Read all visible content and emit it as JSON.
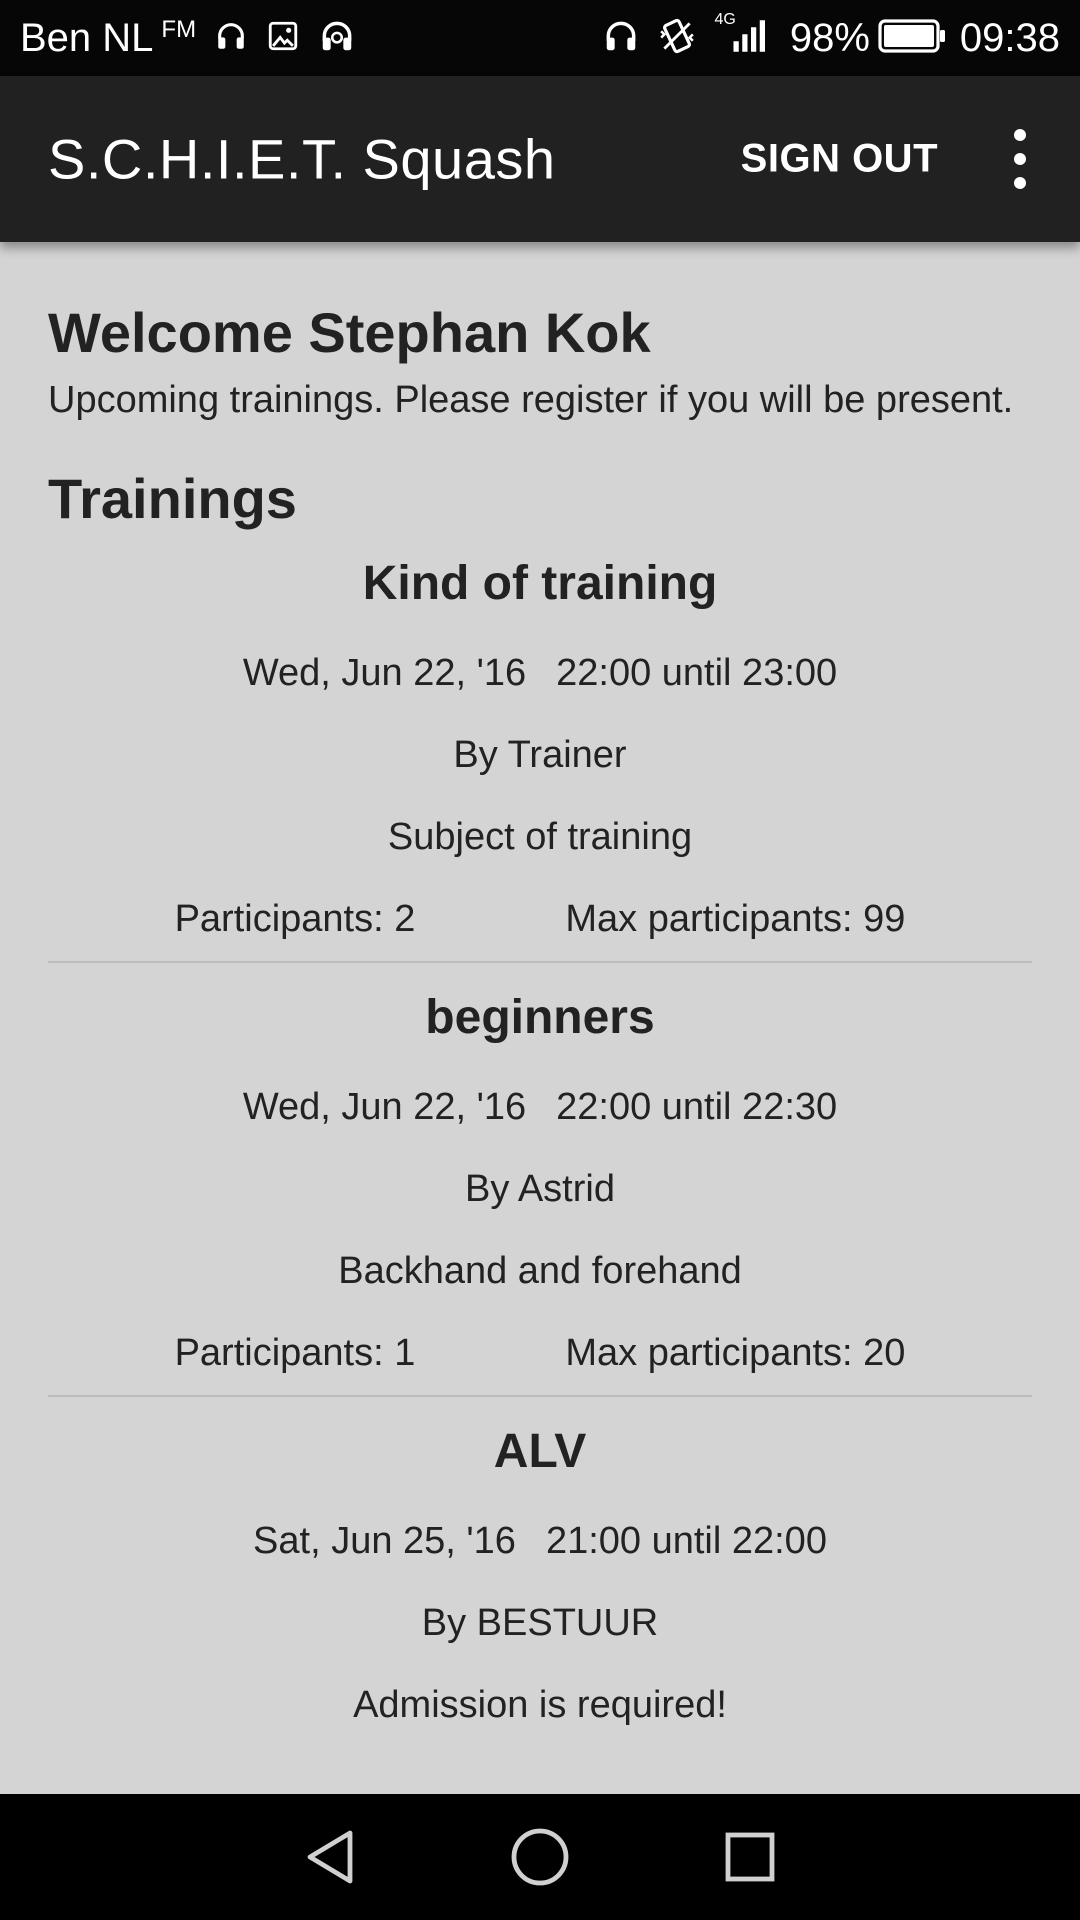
{
  "status_bar": {
    "carrier": "Ben NL",
    "fm": "FM",
    "network": "4G",
    "battery": "98%",
    "time": "09:38"
  },
  "app_bar": {
    "title": "S.C.H.I.E.T. Squash",
    "sign_out": "SIGN OUT",
    "menu_icon": "overflow-menu-icon"
  },
  "welcome": {
    "title": "Welcome Stephan Kok",
    "subtitle": "Upcoming trainings. Please register if you will be present."
  },
  "trainings_heading": "Trainings",
  "trainings": [
    {
      "name": "Kind of training",
      "date": "Wed, Jun 22, '16",
      "time": "22:00 until 23:00",
      "trainer": "By Trainer",
      "subject": "Subject of training",
      "participants": "Participants: 2",
      "max_participants": "Max participants: 99"
    },
    {
      "name": "beginners",
      "date": "Wed, Jun 22, '16",
      "time": "22:00 until 22:30",
      "trainer": "By Astrid",
      "subject": "Backhand and forehand",
      "participants": "Participants: 1",
      "max_participants": "Max participants: 20"
    },
    {
      "name": "ALV",
      "date": "Sat, Jun 25, '16",
      "time": "21:00 until 22:00",
      "trainer": "By BESTUUR",
      "subject": "Admission is required!",
      "participants": "",
      "max_participants": ""
    }
  ],
  "nav": {
    "back": "back-icon",
    "home": "home-icon",
    "recents": "recents-icon"
  },
  "colors": {
    "app_bar": "#212121",
    "background": "#d4d4d4",
    "status_bar": "#060606",
    "divider": "#bdbdbd"
  }
}
